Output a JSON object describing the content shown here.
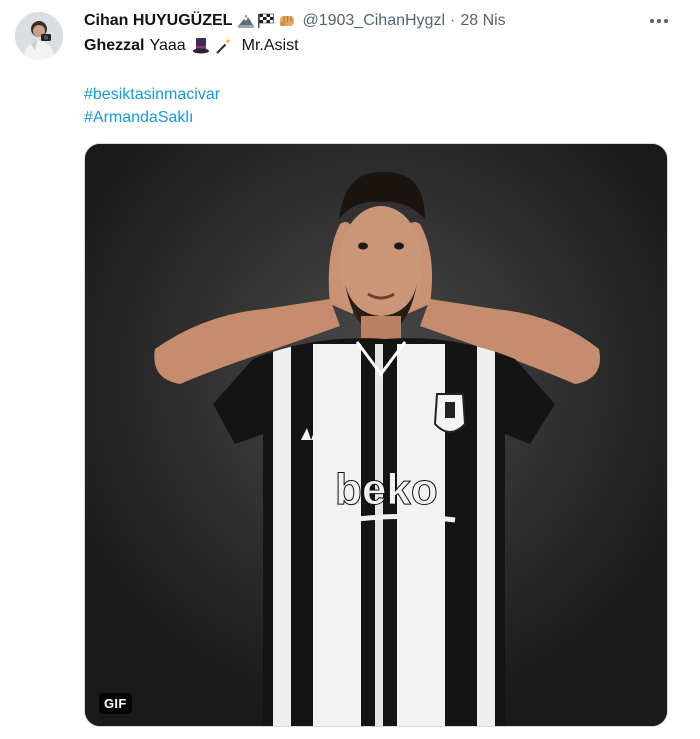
{
  "tweet": {
    "author_name": "Cihan HUYUGÜZEL",
    "name_emojis": [
      "eagle-emoji",
      "checkered-flag-emoji",
      "fist-emoji"
    ],
    "handle": "@1903_CihanHygzl",
    "separator": "·",
    "date": "28 Nis",
    "text_bold": "Ghezzal",
    "text_rest": "Yaaa",
    "text_emojis": [
      "top-hat-emoji",
      "magic-wand-emoji"
    ],
    "text_after": "Mr.Asist",
    "hashtags": [
      "#besiktasinmacivar",
      "#ArmandaSaklı"
    ],
    "media": {
      "type": "gif",
      "badge": "GIF",
      "jersey_sponsor": "beko"
    }
  },
  "colors": {
    "link": "#1b95e0",
    "secondary_text": "#536471",
    "primary_text": "#0f1419"
  }
}
